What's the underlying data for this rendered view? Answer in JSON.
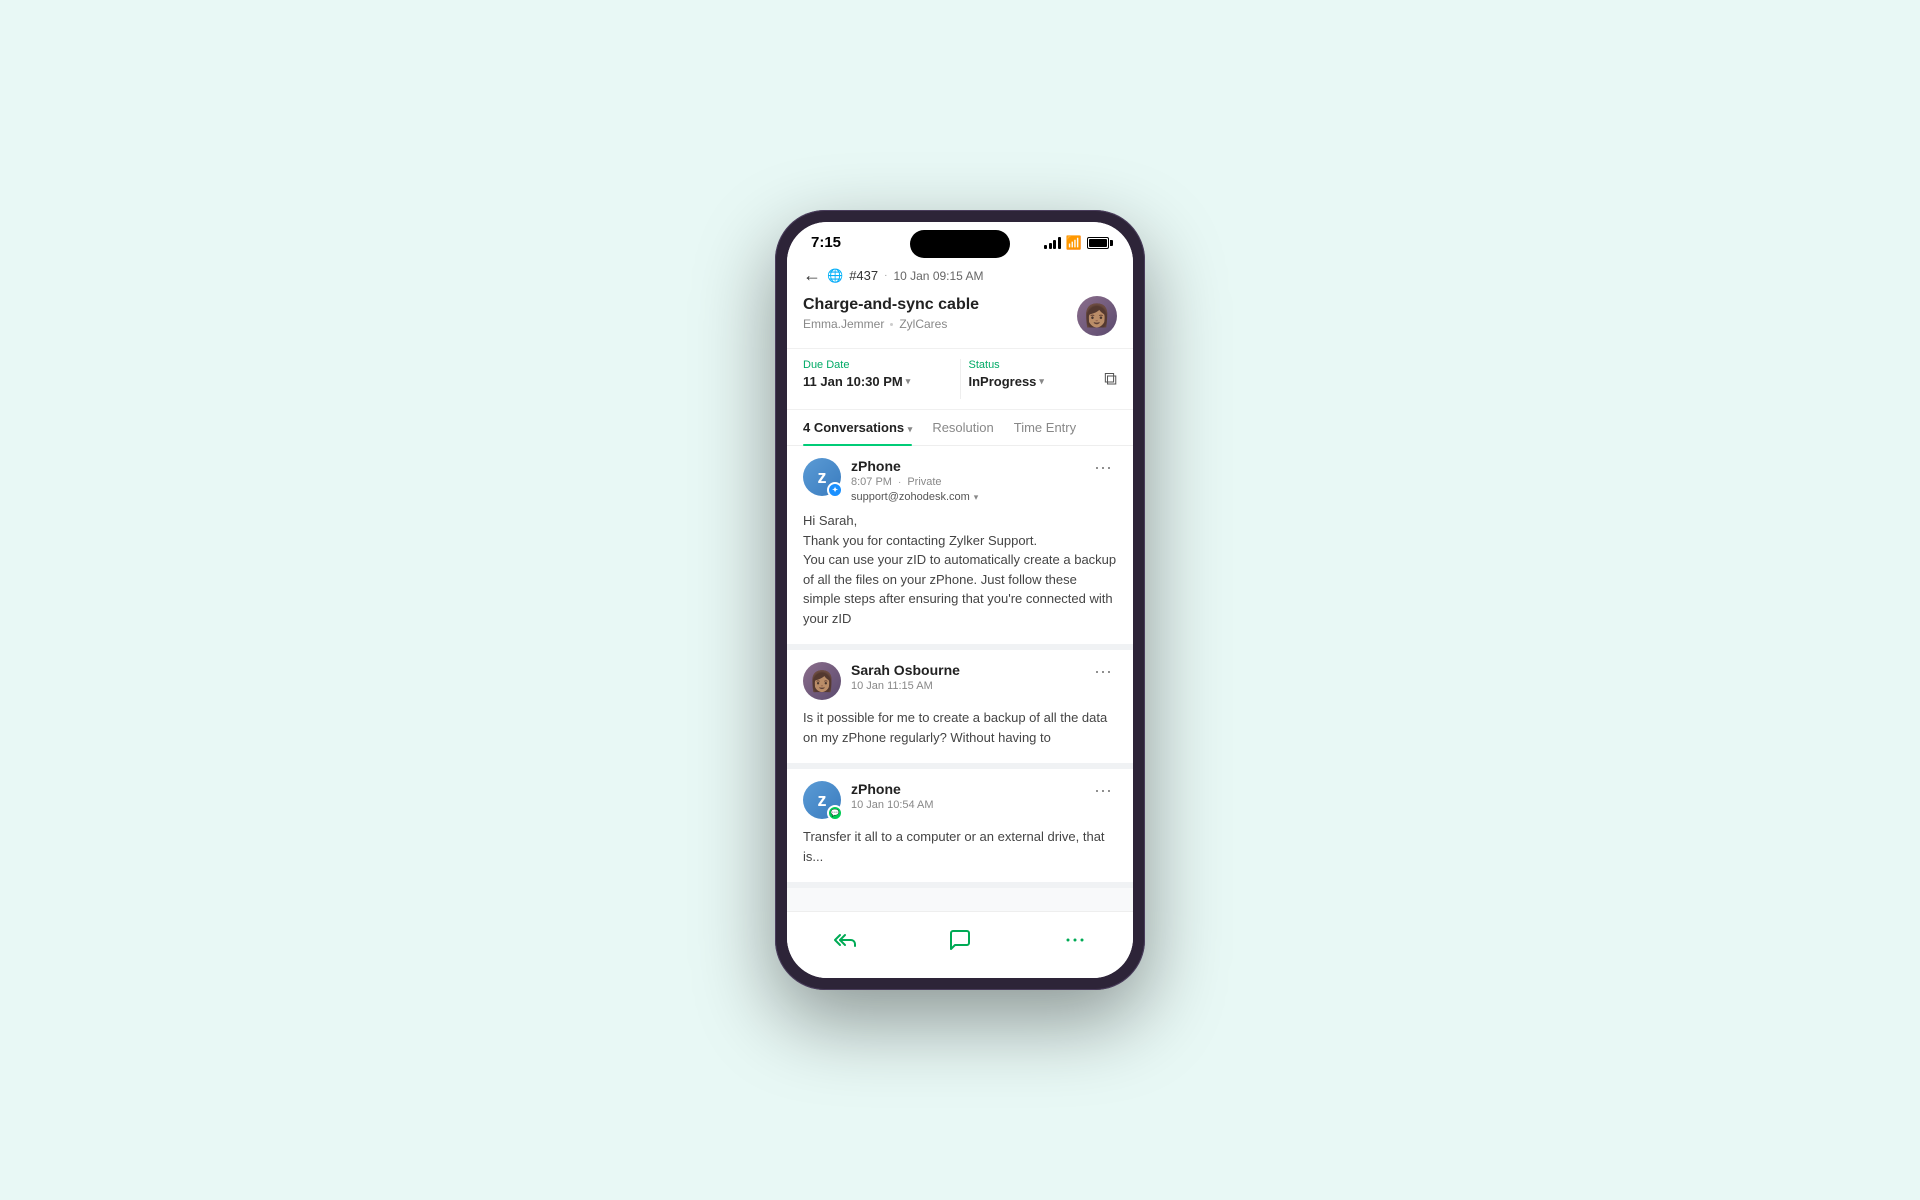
{
  "phone": {
    "status_bar": {
      "time": "7:15",
      "signal_label": "signal",
      "wifi_label": "wifi",
      "battery_label": "battery"
    },
    "header": {
      "back_label": "back",
      "globe_label": "web",
      "ticket_id": "#437",
      "separator": "·",
      "ticket_date": "10 Jan 09:15 AM",
      "ticket_title": "Charge-and-sync cable",
      "agent_name": "Emma.Jemmer",
      "team_name": "ZylCares"
    },
    "fields": {
      "due_date_label": "Due Date",
      "due_date_value": "11 Jan 10:30 PM",
      "status_label": "Status",
      "status_value": "InProgress"
    },
    "tabs": [
      {
        "id": "conversations",
        "label": "4 Conversations",
        "active": true
      },
      {
        "id": "resolution",
        "label": "Resolution",
        "active": false
      },
      {
        "id": "time_entry",
        "label": "Time Entry",
        "active": false
      }
    ],
    "conversations": [
      {
        "id": 1,
        "sender": "zPhone",
        "time": "8:07 PM",
        "privacy": "Private",
        "email": "support@zohodesk.com",
        "avatar_type": "zphone",
        "badge_type": "blue",
        "body": "Hi Sarah,\nThank you for contacting Zylker Support.\nYou can use your zID to automatically create a backup of all the files on your zPhone. Just follow these simple steps after ensuring that you're connected with your zID"
      },
      {
        "id": 2,
        "sender": "Sarah Osbourne",
        "time": "10 Jan 11:15 AM",
        "privacy": "",
        "email": "",
        "avatar_type": "sarah",
        "badge_type": "none",
        "body": "Is it possible for me to create a backup of all the data on my zPhone regularly? Without having to"
      },
      {
        "id": 3,
        "sender": "zPhone",
        "time": "10 Jan 10:54 AM",
        "privacy": "",
        "email": "",
        "avatar_type": "zphone2",
        "badge_type": "green",
        "body": "Transfer it all to a computer or an external drive, that is..."
      }
    ],
    "bottom_nav": {
      "reply_all_label": "reply all",
      "message_label": "new message",
      "more_label": "more options"
    }
  }
}
